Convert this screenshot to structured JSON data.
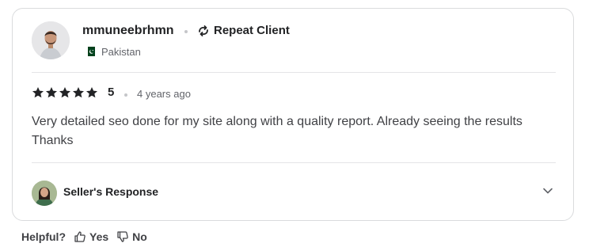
{
  "reviewer": {
    "username": "mmuneebrhmn",
    "badge": "Repeat Client",
    "country": "Pakistan",
    "avatar_icon": "user-avatar-photo",
    "flag_icon": "pakistan-flag-icon"
  },
  "review": {
    "stars": 5,
    "rating": "5",
    "time_ago": "4 years ago",
    "text": "Very detailed seo done for my site along with a quality report. Already seeing the results Thanks"
  },
  "seller_response": {
    "label": "Seller's Response",
    "expanded": false
  },
  "helpful": {
    "question": "Helpful?",
    "yes_label": "Yes",
    "no_label": "No"
  },
  "colors": {
    "star": "#222325",
    "text": "#404145",
    "border": "#dadbdd",
    "muted": "#62646a"
  }
}
